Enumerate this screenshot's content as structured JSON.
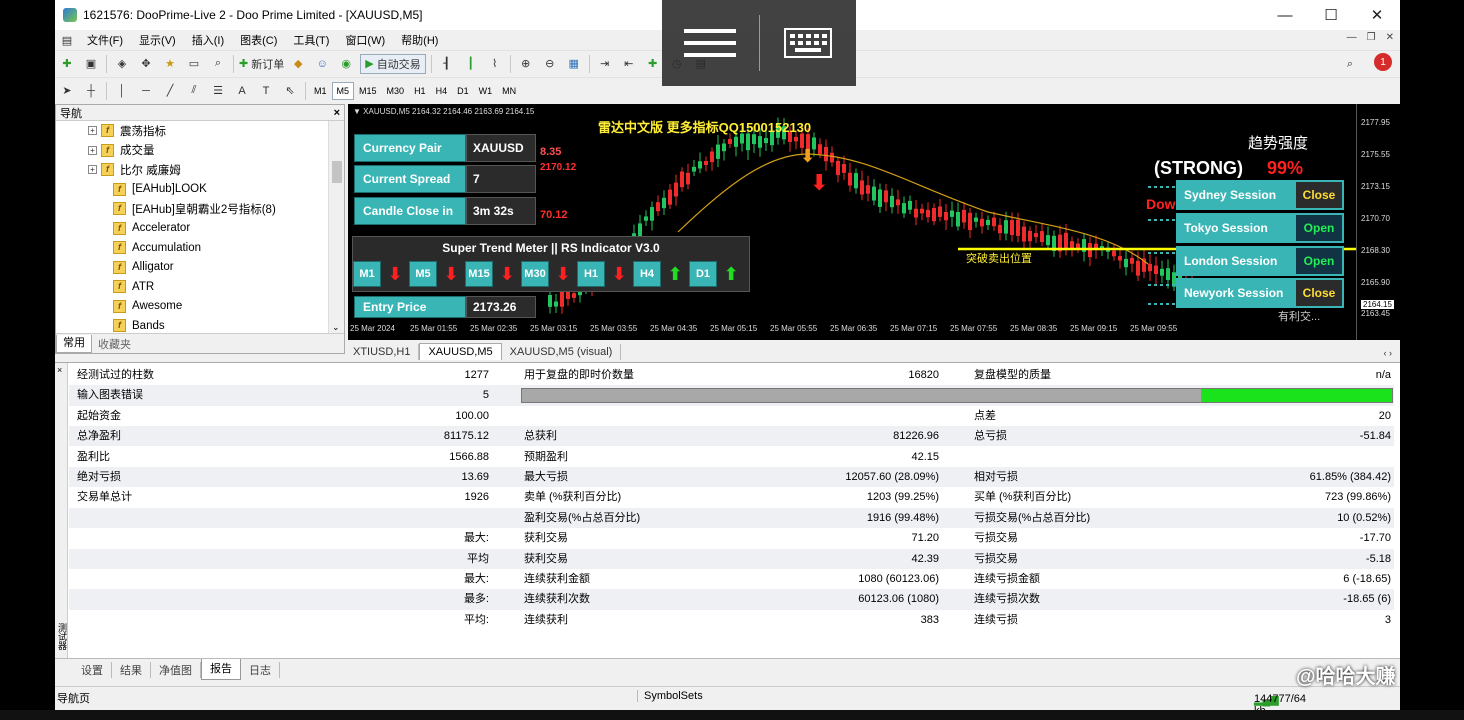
{
  "window": {
    "title": "1621576: DooPrime-Live 2 - Doo Prime Limited - [XAUUSD,M5]",
    "controls": [
      "—",
      "☐",
      "✕"
    ]
  },
  "menu": [
    "文件(F)",
    "显示(V)",
    "插入(I)",
    "图表(C)",
    "工具(T)",
    "窗口(W)",
    "帮助(H)"
  ],
  "toolbar": {
    "new_order": "新订单",
    "autotrade": "自动交易"
  },
  "timeframes": [
    "M1",
    "M5",
    "M15",
    "M30",
    "H1",
    "H4",
    "D1",
    "W1",
    "MN"
  ],
  "timeframe_selected": "M5",
  "notification_count": "1",
  "navigator": {
    "title": "导航",
    "close": "×",
    "items": [
      {
        "label": "震荡指标",
        "expandable": true
      },
      {
        "label": "成交量",
        "expandable": true
      },
      {
        "label": "比尔 威廉姆",
        "expandable": true
      },
      {
        "label": "[EAHub]LOOK",
        "expandable": false
      },
      {
        "label": "[EAHub]皇朝霸业2号指标(8)",
        "expandable": false
      },
      {
        "label": "Accelerator",
        "expandable": false
      },
      {
        "label": "Accumulation",
        "expandable": false
      },
      {
        "label": "Alligator",
        "expandable": false
      },
      {
        "label": "ATR",
        "expandable": false
      },
      {
        "label": "Awesome",
        "expandable": false
      },
      {
        "label": "Bands",
        "expandable": false
      }
    ],
    "tabs": [
      "常用",
      "收藏夹"
    ]
  },
  "chart": {
    "info": "▼ XAUUSD,M5  2164.32 2164.46 2163.69 2164.15",
    "banner": "雷达中文版 更多指标QQ1500152130",
    "left_values": [
      "8.35",
      "2170.12",
      "70.12"
    ],
    "trend_title": "趋势强度",
    "trend_strength": "(STRONG)",
    "trend_percent": "99%",
    "down_label": "Dow",
    "break_label": "突破卖出位置",
    "bottom_right_partial": "有利交...",
    "panel": [
      {
        "label": "Currency Pair",
        "value": "XAUUSD"
      },
      {
        "label": "Current Spread",
        "value": "7"
      },
      {
        "label": "Candle Close in",
        "value": "3m 32s"
      },
      {
        "label": "Entry Price",
        "value": "2173.26"
      }
    ],
    "stm_title": "Super Trend Meter  ||  RS Indicator V3.0",
    "stm_cells": [
      {
        "tf": "M1",
        "dir": "down"
      },
      {
        "tf": "M5",
        "dir": "down"
      },
      {
        "tf": "M15",
        "dir": "down"
      },
      {
        "tf": "M30",
        "dir": "down"
      },
      {
        "tf": "H1",
        "dir": "down"
      },
      {
        "tf": "H4",
        "dir": "up"
      },
      {
        "tf": "D1",
        "dir": "up"
      }
    ],
    "sessions": [
      {
        "name": "Sydney Session",
        "status": "Close"
      },
      {
        "name": "Tokyo Session",
        "status": "Open"
      },
      {
        "name": "London Session",
        "status": "Open"
      },
      {
        "name": "Newyork Session",
        "status": "Close"
      }
    ],
    "price_axis": [
      "2177.95",
      "2175.55",
      "2173.15",
      "2170.70",
      "2168.30",
      "2165.90",
      "2164.15",
      "2163.45"
    ],
    "time_axis": [
      "25 Mar 2024",
      "25 Mar 01:55",
      "25 Mar 02:35",
      "25 Mar 03:15",
      "25 Mar 03:55",
      "25 Mar 04:35",
      "25 Mar 05:15",
      "25 Mar 05:55",
      "25 Mar 06:35",
      "25 Mar 07:15",
      "25 Mar 07:55",
      "25 Mar 08:35",
      "25 Mar 09:15",
      "25 Mar 09:55"
    ],
    "colors": {
      "up": "#22c55e",
      "down": "#ef2b2b",
      "ma": "#d4a017",
      "level": "#ffff00"
    }
  },
  "chart_tabs": [
    "XTIUSD,H1",
    "XAUUSD,M5",
    "XAUUSD,M5 (visual)"
  ],
  "chart_tab_selected": "XAUUSD,M5",
  "report": {
    "rows": [
      {
        "l1": "经测试过的柱数",
        "v1": "1277",
        "l2": "用于复盘的即时价数量",
        "v2": "16820",
        "l3": "复盘模型的质量",
        "v3": "n/a"
      },
      {
        "l1": "输入图表错误",
        "v1": "5",
        "progress": 0.22
      },
      {
        "l1": "起始资金",
        "v1": "100.00",
        "l2": "",
        "v2": "",
        "l3": "点差",
        "v3": "20"
      },
      {
        "l1": "总净盈利",
        "v1": "81175.12",
        "l2": "总获利",
        "v2": "81226.96",
        "l3": "总亏损",
        "v3": "-51.84"
      },
      {
        "l1": "盈利比",
        "v1": "1566.88",
        "l2": "预期盈利",
        "v2": "42.15",
        "l3": "",
        "v3": ""
      },
      {
        "l1": "绝对亏损",
        "v1": "13.69",
        "l2": "最大亏损",
        "v2": "12057.60 (28.09%)",
        "l3": "相对亏损",
        "v3": "61.85% (384.42)"
      },
      {
        "l1": "交易单总计",
        "v1": "1926",
        "l2": "卖单 (%获利百分比)",
        "v2": "1203 (99.25%)",
        "l3": "买单 (%获利百分比)",
        "v3": "723 (99.86%)"
      },
      {
        "l1": "",
        "v1": "",
        "l2": "盈利交易(%占总百分比)",
        "v2": "1916 (99.48%)",
        "l3": "亏损交易(%占总百分比)",
        "v3": "10 (0.52%)"
      },
      {
        "l1": "",
        "v1": "最大:",
        "l2": "获利交易",
        "v2": "71.20",
        "l3": "亏损交易",
        "v3": "-17.70"
      },
      {
        "l1": "",
        "v1": "平均",
        "l2": "获利交易",
        "v2": "42.39",
        "l3": "亏损交易",
        "v3": "-5.18"
      },
      {
        "l1": "",
        "v1": "最大:",
        "l2": "连续获利金额",
        "v2": "1080 (60123.06)",
        "l3": "连续亏损金额",
        "v3": "6 (-18.65)"
      },
      {
        "l1": "",
        "v1": "最多:",
        "l2": "连续获利次数",
        "v2": "60123.06 (1080)",
        "l3": "连续亏损次数",
        "v3": "-18.65 (6)"
      },
      {
        "l1": "",
        "v1": "平均:",
        "l2": "连续获利",
        "v2": "383",
        "l3": "连续亏损",
        "v3": "3"
      }
    ],
    "side_label": "测试器",
    "tabs": [
      "设置",
      "结果",
      "净值图",
      "报告",
      "日志"
    ],
    "tab_selected": "报告"
  },
  "status": {
    "left": "导航页",
    "mid": "SymbolSets",
    "right": "144777/64 kb"
  },
  "watermark": "@哈哈大赚"
}
